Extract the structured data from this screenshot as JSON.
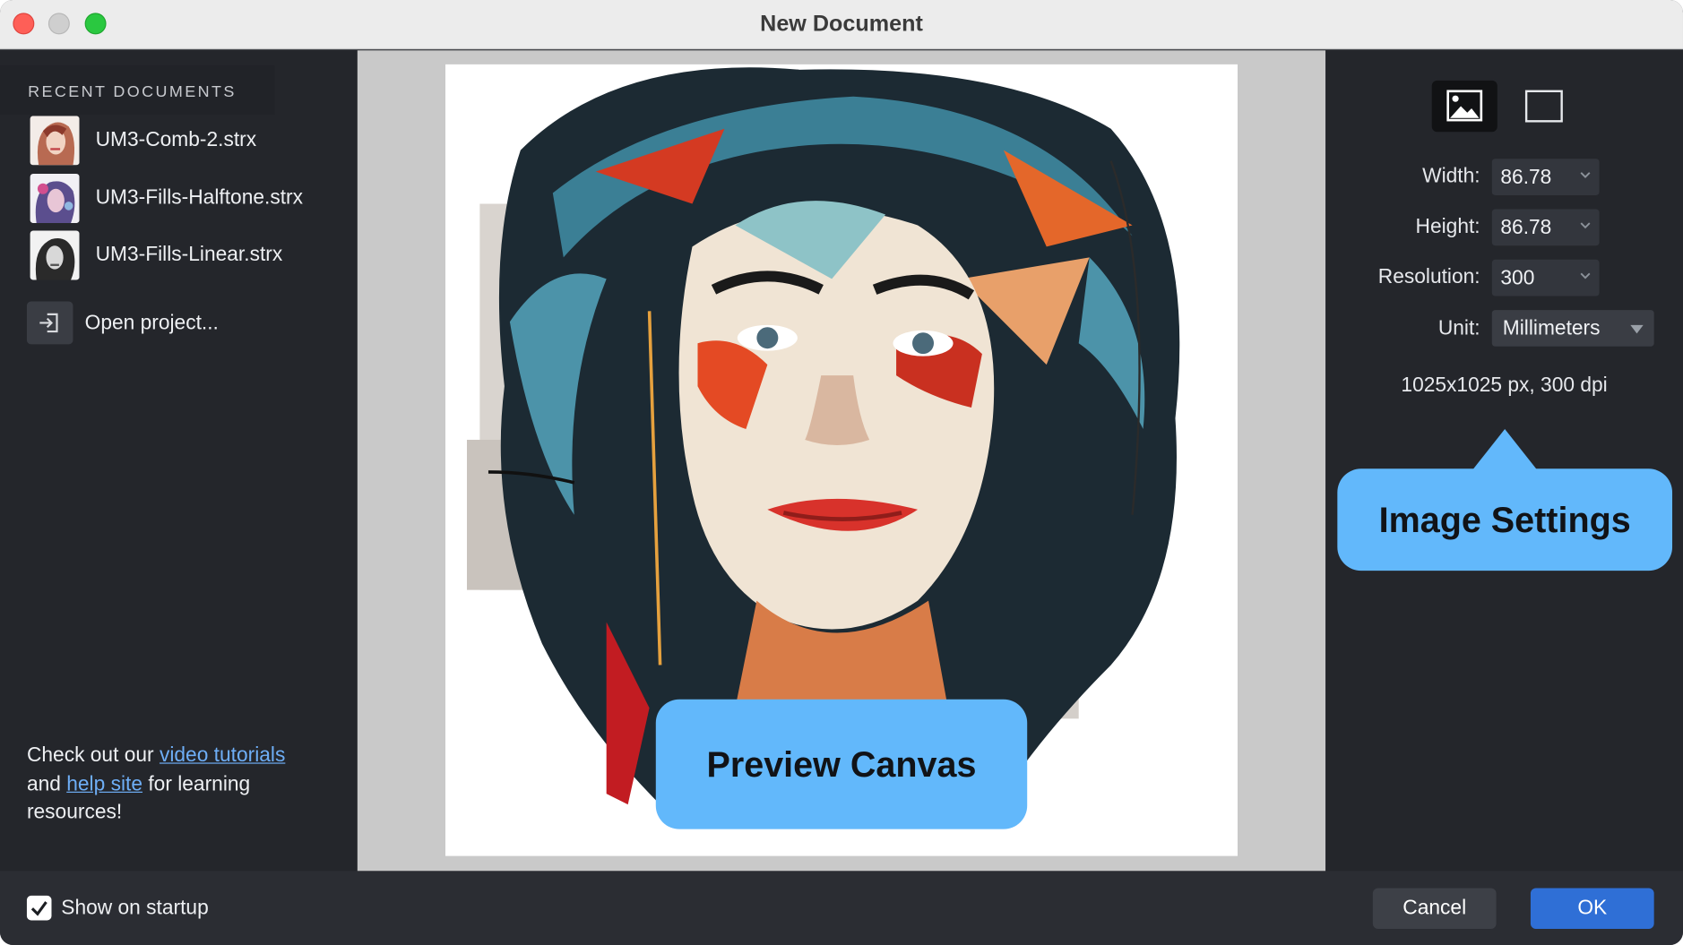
{
  "window": {
    "title": "New Document"
  },
  "recent": {
    "header": "RECENT DOCUMENTS",
    "items": [
      {
        "name": "UM3-Comb-2.strx"
      },
      {
        "name": "UM3-Fills-Halftone.strx"
      },
      {
        "name": "UM3-Fills-Linear.strx"
      }
    ],
    "open_label": "Open project..."
  },
  "resources": {
    "prefix": "Check out our",
    "video_link": "video tutorials",
    "mid": "and",
    "help_link": "help site",
    "suffix": "for learning resources!"
  },
  "canvas": {
    "callout": "Preview Canvas"
  },
  "settings": {
    "fields": {
      "width": {
        "label": "Width:",
        "value": "86.78"
      },
      "height": {
        "label": "Height:",
        "value": "86.78"
      },
      "resolution": {
        "label": "Resolution:",
        "value": "300"
      },
      "unit": {
        "label": "Unit:",
        "value": "Millimeters"
      }
    },
    "summary": "1025x1025 px, 300 dpi",
    "callout": "Image Settings",
    "modes": {
      "selected": "image-icon"
    }
  },
  "footer": {
    "show_on_startup": {
      "label": "Show on startup",
      "checked": true
    },
    "cancel_label": "Cancel",
    "ok_label": "OK"
  },
  "colors": {
    "accent": "#2f6fd6",
    "callout": "#62b8fb",
    "link": "#6eaef6",
    "panel": "#24262b"
  }
}
